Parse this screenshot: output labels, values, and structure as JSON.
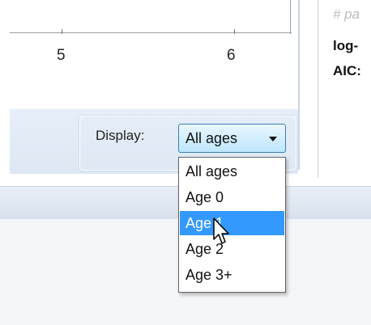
{
  "chart": {
    "tick_labels": [
      "5",
      "6"
    ]
  },
  "info_panel": {
    "line1": "# pa",
    "line2": "log-",
    "line3": "AIC:"
  },
  "display": {
    "label": "Display:",
    "selected_value": "All ages",
    "options": [
      "All ages",
      "Age 0",
      "Age 1",
      "Age 2",
      "Age 3+"
    ],
    "highlighted_option": "Age 1"
  },
  "colors": {
    "highlight": "#3399ff",
    "panel_blue": "#e6eef8"
  }
}
